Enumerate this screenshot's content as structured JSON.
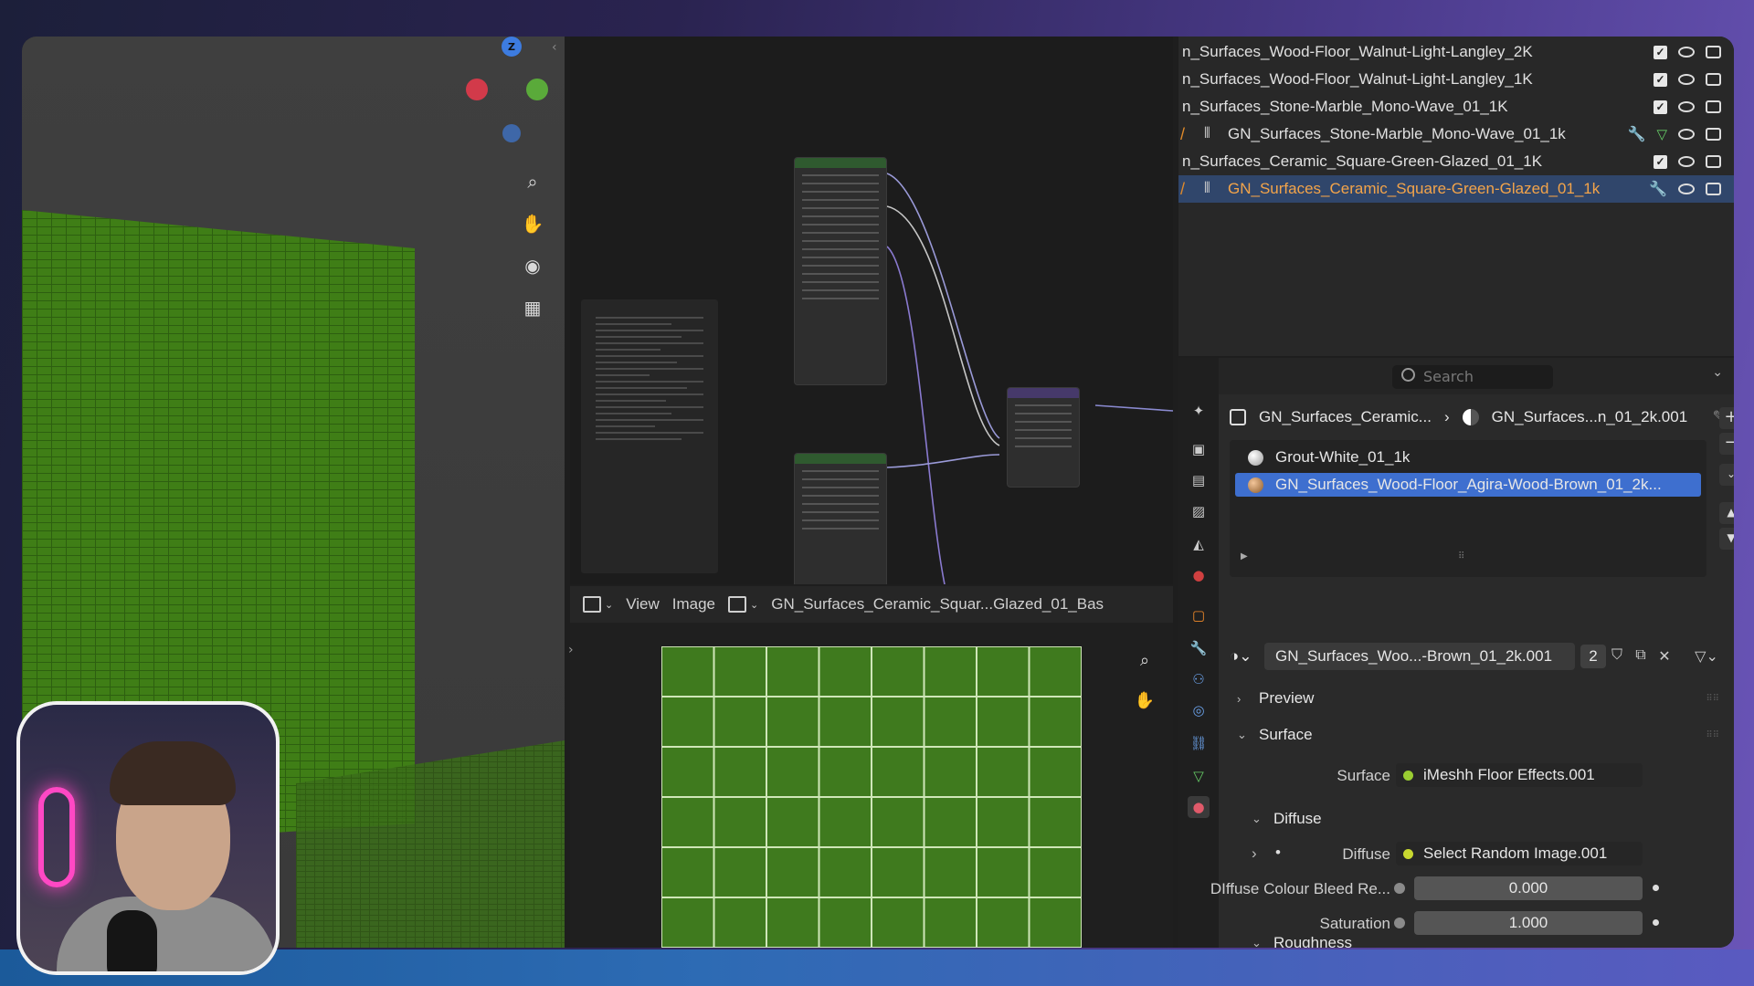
{
  "image_editor": {
    "menu_view": "View",
    "menu_image": "Image",
    "image_name": "GN_Surfaces_Ceramic_Squar...Glazed_01_Bas"
  },
  "outliner": {
    "rows": [
      {
        "name": "n_Surfaces_Wood-Floor_Walnut-Light-Langley_2K"
      },
      {
        "name": "n_Surfaces_Wood-Floor_Walnut-Light-Langley_1K"
      },
      {
        "name": "n_Surfaces_Stone-Marble_Mono-Wave_01_1K"
      },
      {
        "name": "GN_Surfaces_Stone-Marble_Mono-Wave_01_1k"
      },
      {
        "name": "n_Surfaces_Ceramic_Square-Green-Glazed_01_1K"
      },
      {
        "name": "GN_Surfaces_Ceramic_Square-Green-Glazed_01_1k"
      }
    ]
  },
  "properties": {
    "search_placeholder": "Search",
    "breadcrumb": {
      "object": "GN_Surfaces_Ceramic...",
      "material": "GN_Surfaces...n_01_2k.001"
    },
    "material_slots": [
      {
        "name": "Grout-White_01_1k"
      },
      {
        "name": "GN_Surfaces_Wood-Floor_Agira-Wood-Brown_01_2k..."
      }
    ],
    "material": {
      "name": "GN_Surfaces_Woo...-Brown_01_2k.001",
      "users": "2"
    },
    "panels": {
      "preview": "Preview",
      "surface": "Surface",
      "diffuse_group": "Diffuse",
      "roughness_group": "Roughness"
    },
    "fields": {
      "surface_label": "Surface",
      "surface_value": "iMeshh Floor Effects.001",
      "diffuse_label": "Diffuse",
      "diffuse_value": "Select Random Image.001",
      "bleed_label": "DIffuse Colour Bleed Re...",
      "bleed_value": "0.000",
      "saturation_label": "Saturation",
      "saturation_value": "1.000"
    }
  },
  "colors": {
    "selection_blue": "#3e6fcf",
    "active_orange": "#f3a44a",
    "tile_green": "#3f7a1e"
  }
}
